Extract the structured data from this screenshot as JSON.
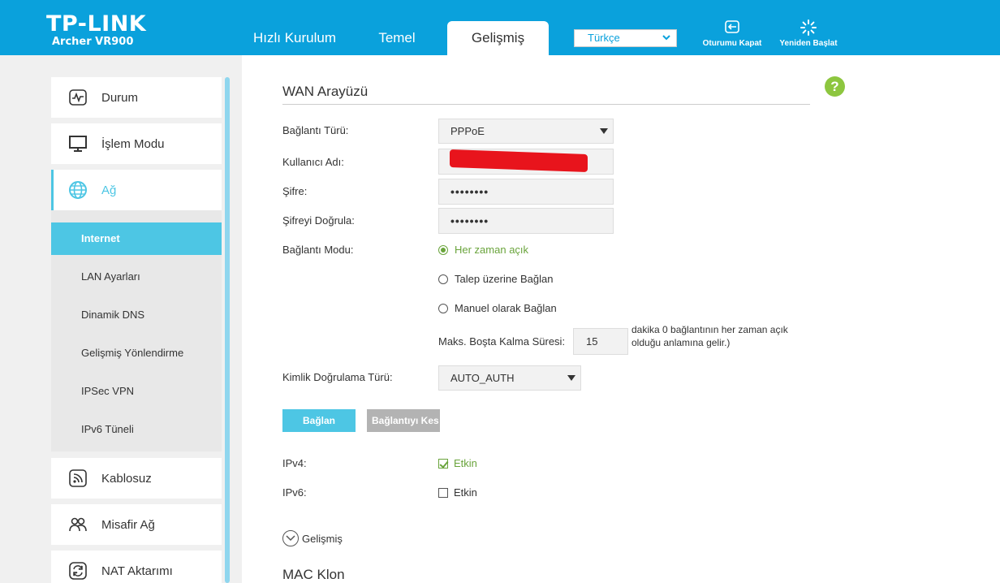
{
  "brand": {
    "logo": "TP-LINK",
    "model": "Archer VR900"
  },
  "nav": {
    "tabs": [
      {
        "label": "Hızlı Kurulum"
      },
      {
        "label": "Temel"
      },
      {
        "label": "Gelişmiş"
      }
    ],
    "active_tab": "Gelişmiş",
    "language": "Türkçe",
    "logout_label": "Oturumu Kapat",
    "reboot_label": "Yeniden Başlat"
  },
  "sidebar": {
    "items": [
      {
        "label": "Durum",
        "icon": "status-icon"
      },
      {
        "label": "İşlem Modu",
        "icon": "monitor-icon"
      },
      {
        "label": "Ağ",
        "icon": "globe-icon"
      },
      {
        "label": "Kablosuz",
        "icon": "wireless-icon"
      },
      {
        "label": "Misafir Ağ",
        "icon": "guest-icon"
      },
      {
        "label": "NAT Aktarımı",
        "icon": "nat-icon"
      }
    ],
    "submenu": [
      {
        "label": "Internet"
      },
      {
        "label": "LAN Ayarları"
      },
      {
        "label": "Dinamik DNS"
      },
      {
        "label": "Gelişmiş Yönlendirme"
      },
      {
        "label": "IPSec VPN"
      },
      {
        "label": "IPv6 Tüneli"
      }
    ]
  },
  "wan": {
    "title": "WAN Arayüzü",
    "help_label": "?",
    "connection_type_label": "Bağlantı Türü:",
    "connection_type_value": "PPPoE",
    "username_label": "Kullanıcı Adı:",
    "password_label": "Şifre:",
    "password_value": "••••••••",
    "confirm_password_label": "Şifreyi Doğrula:",
    "confirm_password_value": "••••••••",
    "connection_mode_label": "Bağlantı Modu:",
    "modes": [
      {
        "label": "Her zaman açık",
        "selected": true
      },
      {
        "label": "Talep üzerine Bağlan",
        "selected": false
      },
      {
        "label": "Manuel olarak Bağlan",
        "selected": false
      }
    ],
    "idle_label": "Maks. Boşta Kalma Süresi:",
    "idle_value": "15",
    "idle_note": "dakika 0 bağlantının her zaman açık olduğu anlamına gelir.)",
    "auth_type_label": "Kimlik Doğrulama Türü:",
    "auth_type_value": "AUTO_AUTH",
    "connect_button": "Bağlan",
    "disconnect_button": "Bağlantıyı Kes",
    "ipv4_label": "IPv4:",
    "ipv4_enabled": "Etkin",
    "ipv6_label": "IPv6:",
    "ipv6_enabled": "Etkin",
    "advanced_label": "Gelişmiş",
    "mac_clone_title": "MAC Klon"
  },
  "colors": {
    "header": "#0aa1dc",
    "accent": "#4dc6e4",
    "green": "#6aa43c",
    "help": "#8dc63f",
    "disabled_button": "#b3b3b3"
  }
}
